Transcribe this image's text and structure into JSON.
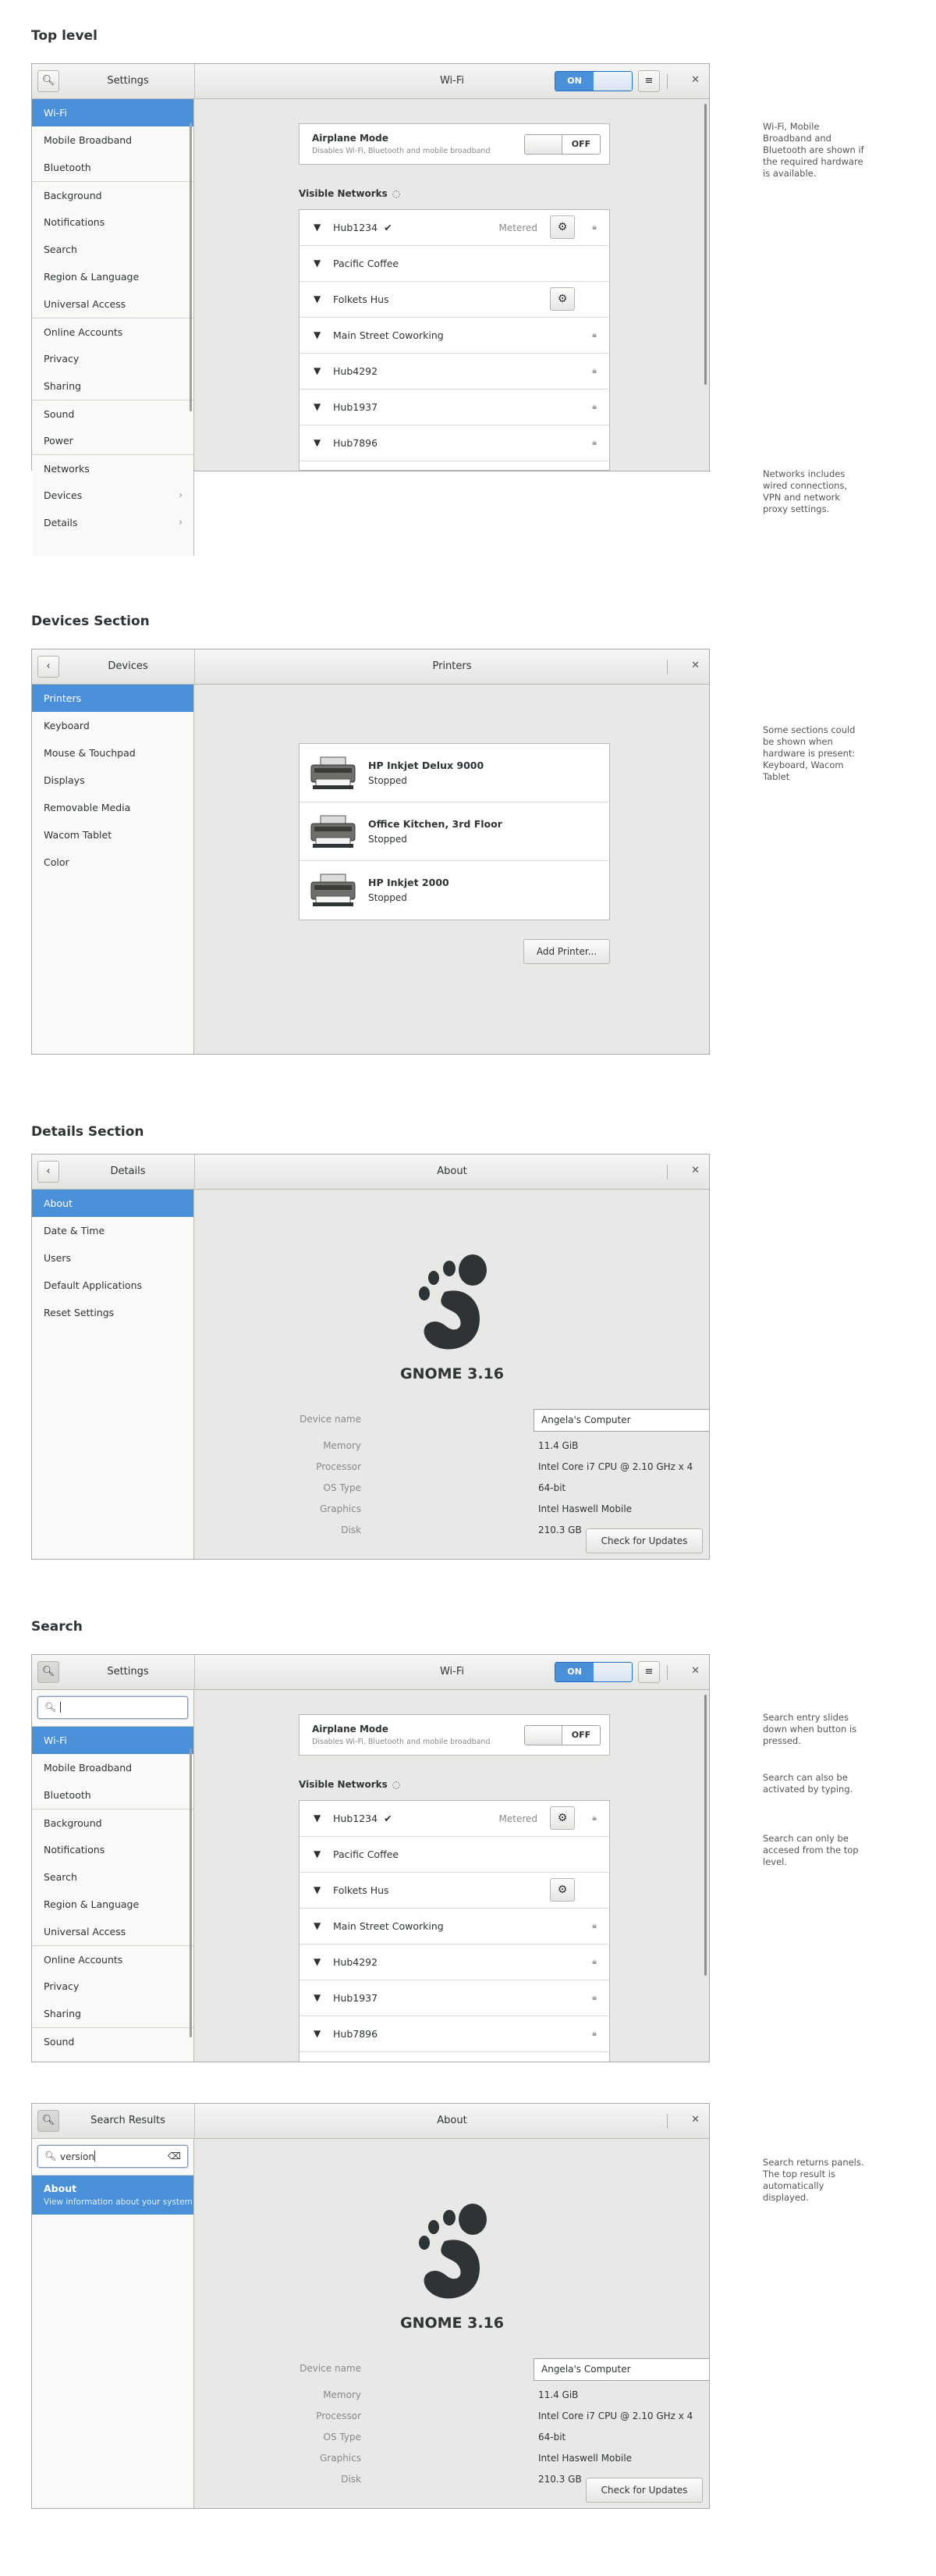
{
  "sections": {
    "top": "Top level",
    "devices": "Devices Section",
    "details": "Details Section",
    "search": "Search"
  },
  "notes": {
    "top1": "Wi-Fi, Mobile Broadband and Bluetooth are shown if the required hardware is available.",
    "top2": "Networks includes wired connections, VPN and network proxy settings.",
    "devices": "Some sections could be shown when hardware is present: Keyboard, Wacom Tablet",
    "search1": "Search entry slides down when button is pressed.",
    "search2": "Search can also be activated by typing.",
    "search3": "Search can only be accesed from the top level.",
    "results": "Search returns panels. The top result is automatically displayed."
  },
  "icons": {
    "search": "search-icon",
    "back": "back-arrow-icon",
    "menu": "hamburger-menu-icon",
    "close": "close-icon",
    "gear": "gear-icon",
    "lock": "lock-icon",
    "wifi": "wifi-signal-icon",
    "check": "checkmark-icon",
    "chevron": "chevron-right-icon",
    "printer": "printer-icon",
    "gnome": "gnome-foot-logo",
    "clear": "clear-entry-icon"
  },
  "colors": {
    "accent": "#4a90d9",
    "sidebar_bg": "#f9f9f8",
    "content_bg": "#e8e8e7"
  },
  "top": {
    "left_title": "Settings",
    "title": "Wi-Fi",
    "switch_on": "ON",
    "sidebar": [
      "Wi-Fi",
      "Mobile Broadband",
      "Bluetooth",
      "Background",
      "Notifications",
      "Search",
      "Region & Language",
      "Universal Access",
      "Online Accounts",
      "Privacy",
      "Sharing",
      "Sound",
      "Power",
      "Networks",
      "Devices",
      "Details"
    ],
    "airplane_title": "Airplane Mode",
    "airplane_sub": "Disables Wi-Fi, Bluetooth and mobile broadband",
    "switch_off": "OFF",
    "visible": "Visible Networks",
    "metered": "Metered",
    "networks": [
      "Hub1234",
      "Pacific Coffee",
      "Folkets Hus",
      "Main Street Coworking",
      "Hub4292",
      "Hub1937",
      "Hub7896"
    ]
  },
  "devices": {
    "left_title": "Devices",
    "title": "Printers",
    "sidebar": [
      "Printers",
      "Keyboard",
      "Mouse & Touchpad",
      "Displays",
      "Removable Media",
      "Wacom Tablet",
      "Color"
    ],
    "printers": [
      {
        "name": "HP Inkjet Delux 9000",
        "status": "Stopped"
      },
      {
        "name": "Office Kitchen, 3rd Floor",
        "status": "Stopped"
      },
      {
        "name": "HP Inkjet 2000",
        "status": "Stopped"
      }
    ],
    "add_button": "Add Printer..."
  },
  "about": {
    "version": "GNOME 3.16",
    "device_label": "Device name",
    "device_value": "Angela's Computer",
    "rows": [
      {
        "k": "Memory",
        "v": "11.4 GiB"
      },
      {
        "k": "Processor",
        "v": "Intel Core i7 CPU @ 2.10 GHz x 4"
      },
      {
        "k": "OS Type",
        "v": "64-bit"
      },
      {
        "k": "Graphics",
        "v": "Intel Haswell Mobile"
      },
      {
        "k": "Disk",
        "v": "210.3 GB"
      }
    ],
    "update_button": "Check for Updates"
  },
  "details": {
    "left_title": "Details",
    "title": "About",
    "sidebar": [
      "About",
      "Date & Time",
      "Users",
      "Default Applications",
      "Reset Settings"
    ]
  },
  "search": {
    "left_title": "Settings",
    "title": "Wi-Fi",
    "query": ""
  },
  "results": {
    "left_title": "Search Results",
    "title": "About",
    "query": "version",
    "result_title": "About",
    "result_sub": "View information about your system"
  }
}
